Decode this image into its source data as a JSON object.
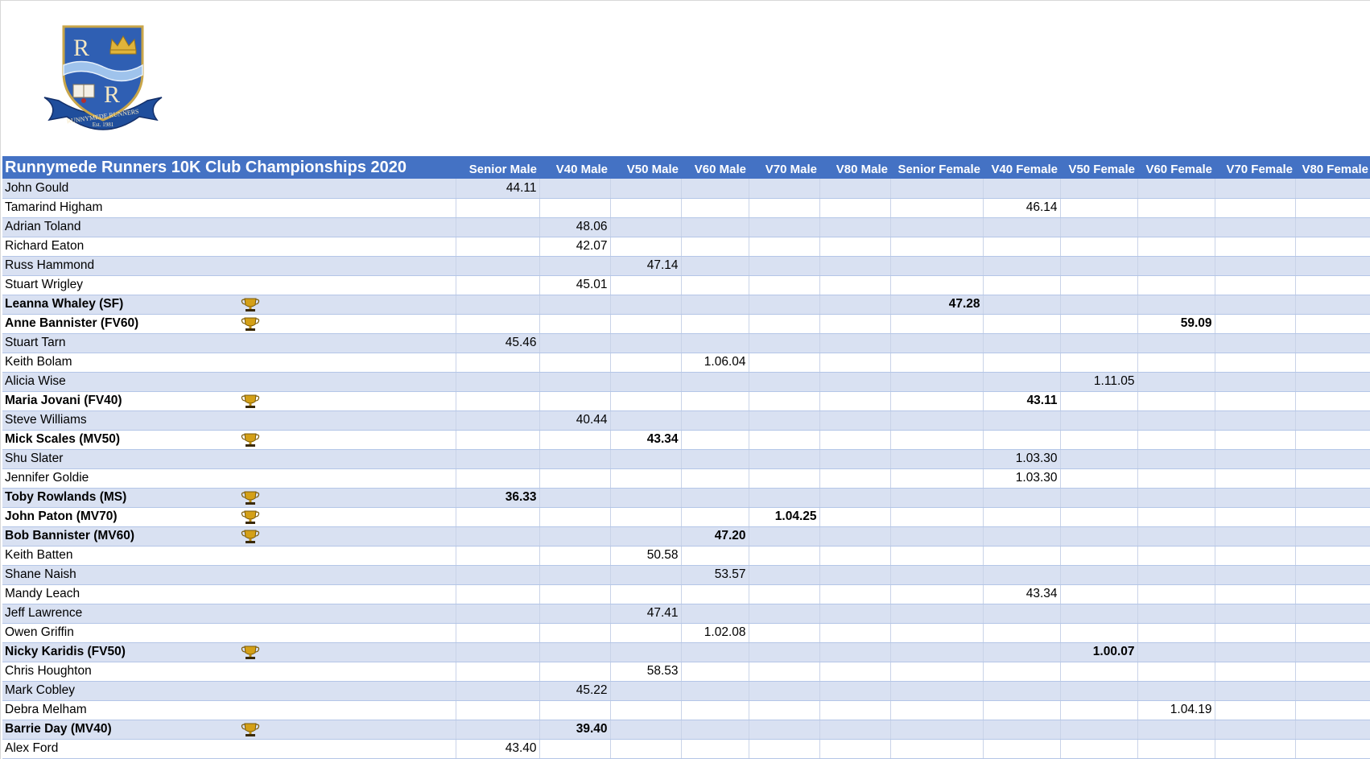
{
  "logo": {
    "letters": [
      "R",
      "R"
    ],
    "banner_text": "RUNNYMEDE RUNNERS",
    "est_text": "Est. 1981"
  },
  "title": "Runnymede Runners 10K Club Championships 2020",
  "columns": [
    "Senior Male",
    "V40 Male",
    "V50 Male",
    "V60 Male",
    "V70 Male",
    "V80 Male",
    "Senior Female",
    "V40 Female",
    "V50 Female",
    "V60 Female",
    "V70 Female",
    "V80 Female"
  ],
  "rows": [
    {
      "name": "John Gould",
      "trophy": false,
      "cells": [
        "44.11",
        "",
        "",
        "",
        "",
        "",
        "",
        "",
        "",
        "",
        "",
        ""
      ]
    },
    {
      "name": "Tamarind Higham",
      "trophy": false,
      "cells": [
        "",
        "",
        "",
        "",
        "",
        "",
        "",
        "46.14",
        "",
        "",
        "",
        ""
      ]
    },
    {
      "name": "Adrian Toland",
      "trophy": false,
      "cells": [
        "",
        "48.06",
        "",
        "",
        "",
        "",
        "",
        "",
        "",
        "",
        "",
        ""
      ]
    },
    {
      "name": "Richard Eaton",
      "trophy": false,
      "cells": [
        "",
        "42.07",
        "",
        "",
        "",
        "",
        "",
        "",
        "",
        "",
        "",
        ""
      ]
    },
    {
      "name": "Russ Hammond",
      "trophy": false,
      "cells": [
        "",
        "",
        "47.14",
        "",
        "",
        "",
        "",
        "",
        "",
        "",
        "",
        ""
      ]
    },
    {
      "name": "Stuart Wrigley",
      "trophy": false,
      "cells": [
        "",
        "45.01",
        "",
        "",
        "",
        "",
        "",
        "",
        "",
        "",
        "",
        ""
      ]
    },
    {
      "name": "Leanna Whaley (SF)",
      "trophy": true,
      "cells": [
        "",
        "",
        "",
        "",
        "",
        "",
        "47.28",
        "",
        "",
        "",
        "",
        ""
      ]
    },
    {
      "name": "Anne Bannister (FV60)",
      "trophy": true,
      "cells": [
        "",
        "",
        "",
        "",
        "",
        "",
        "",
        "",
        "",
        "59.09",
        "",
        ""
      ]
    },
    {
      "name": "Stuart Tarn",
      "trophy": false,
      "cells": [
        "45.46",
        "",
        "",
        "",
        "",
        "",
        "",
        "",
        "",
        "",
        "",
        ""
      ]
    },
    {
      "name": "Keith Bolam",
      "trophy": false,
      "cells": [
        "",
        "",
        "",
        "1.06.04",
        "",
        "",
        "",
        "",
        "",
        "",
        "",
        ""
      ]
    },
    {
      "name": "Alicia Wise",
      "trophy": false,
      "cells": [
        "",
        "",
        "",
        "",
        "",
        "",
        "",
        "",
        "1.11.05",
        "",
        "",
        ""
      ]
    },
    {
      "name": "Maria Jovani (FV40)",
      "trophy": true,
      "cells": [
        "",
        "",
        "",
        "",
        "",
        "",
        "",
        "43.11",
        "",
        "",
        "",
        ""
      ]
    },
    {
      "name": "Steve Williams",
      "trophy": false,
      "cells": [
        "",
        "40.44",
        "",
        "",
        "",
        "",
        "",
        "",
        "",
        "",
        "",
        ""
      ]
    },
    {
      "name": "Mick Scales (MV50)",
      "trophy": true,
      "cells": [
        "",
        "",
        "43.34",
        "",
        "",
        "",
        "",
        "",
        "",
        "",
        "",
        ""
      ]
    },
    {
      "name": "Shu Slater",
      "trophy": false,
      "cells": [
        "",
        "",
        "",
        "",
        "",
        "",
        "",
        "1.03.30",
        "",
        "",
        "",
        ""
      ]
    },
    {
      "name": "Jennifer Goldie",
      "trophy": false,
      "cells": [
        "",
        "",
        "",
        "",
        "",
        "",
        "",
        "1.03.30",
        "",
        "",
        "",
        ""
      ]
    },
    {
      "name": "Toby Rowlands (MS)",
      "trophy": true,
      "cells": [
        "36.33",
        "",
        "",
        "",
        "",
        "",
        "",
        "",
        "",
        "",
        "",
        ""
      ]
    },
    {
      "name": "John Paton (MV70)",
      "trophy": true,
      "cells": [
        "",
        "",
        "",
        "",
        "1.04.25",
        "",
        "",
        "",
        "",
        "",
        "",
        ""
      ]
    },
    {
      "name": "Bob Bannister (MV60)",
      "trophy": true,
      "cells": [
        "",
        "",
        "",
        "47.20",
        "",
        "",
        "",
        "",
        "",
        "",
        "",
        ""
      ]
    },
    {
      "name": "Keith Batten",
      "trophy": false,
      "cells": [
        "",
        "",
        "50.58",
        "",
        "",
        "",
        "",
        "",
        "",
        "",
        "",
        ""
      ]
    },
    {
      "name": "Shane Naish",
      "trophy": false,
      "cells": [
        "",
        "",
        "",
        "53.57",
        "",
        "",
        "",
        "",
        "",
        "",
        "",
        ""
      ]
    },
    {
      "name": "Mandy Leach",
      "trophy": false,
      "cells": [
        "",
        "",
        "",
        "",
        "",
        "",
        "",
        "43.34",
        "",
        "",
        "",
        ""
      ]
    },
    {
      "name": "Jeff Lawrence",
      "trophy": false,
      "cells": [
        "",
        "",
        "47.41",
        "",
        "",
        "",
        "",
        "",
        "",
        "",
        "",
        ""
      ]
    },
    {
      "name": "Owen Griffin",
      "trophy": false,
      "cells": [
        "",
        "",
        "",
        "1.02.08",
        "",
        "",
        "",
        "",
        "",
        "",
        "",
        ""
      ]
    },
    {
      "name": "Nicky Karidis (FV50)",
      "trophy": true,
      "cells": [
        "",
        "",
        "",
        "",
        "",
        "",
        "",
        "",
        "1.00.07",
        "",
        "",
        ""
      ]
    },
    {
      "name": "Chris Houghton",
      "trophy": false,
      "cells": [
        "",
        "",
        "58.53",
        "",
        "",
        "",
        "",
        "",
        "",
        "",
        "",
        ""
      ]
    },
    {
      "name": "Mark Cobley",
      "trophy": false,
      "cells": [
        "",
        "45.22",
        "",
        "",
        "",
        "",
        "",
        "",
        "",
        "",
        "",
        ""
      ]
    },
    {
      "name": "Debra Melham",
      "trophy": false,
      "cells": [
        "",
        "",
        "",
        "",
        "",
        "",
        "",
        "",
        "",
        "1.04.19",
        "",
        ""
      ]
    },
    {
      "name": "Barrie Day (MV40)",
      "trophy": true,
      "cells": [
        "",
        "39.40",
        "",
        "",
        "",
        "",
        "",
        "",
        "",
        "",
        "",
        ""
      ]
    },
    {
      "name": "Alex Ford",
      "trophy": false,
      "cells": [
        "43.40",
        "",
        "",
        "",
        "",
        "",
        "",
        "",
        "",
        "",
        "",
        ""
      ]
    }
  ],
  "colors": {
    "header_bg": "#4472c4",
    "band_bg": "#d9e1f2",
    "trophy_gold": "#d4a017"
  },
  "icons": {
    "trophy": "trophy-icon",
    "logo": "club-crest-logo"
  }
}
